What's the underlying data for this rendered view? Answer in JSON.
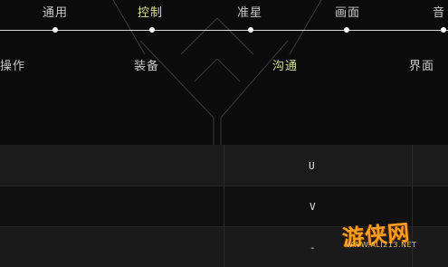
{
  "tabs_top": [
    {
      "label": "通用"
    },
    {
      "label": "控制"
    },
    {
      "label": "准星"
    },
    {
      "label": "画面"
    },
    {
      "label": "音"
    }
  ],
  "tabs_bottom": [
    {
      "label": "操作"
    },
    {
      "label": "装备"
    },
    {
      "label": "沟通"
    },
    {
      "label": "界面"
    }
  ],
  "rows": [
    {
      "value": "U"
    },
    {
      "value": "V"
    },
    {
      "value": "-"
    }
  ],
  "watermark": {
    "text": "游侠网",
    "url": "WWW.ALI213.NET"
  },
  "colors": {
    "background": "#0b0b0b",
    "active_tab": "#d9df9a",
    "rail": "#d8d8d8",
    "watermark": "#f3a020"
  }
}
